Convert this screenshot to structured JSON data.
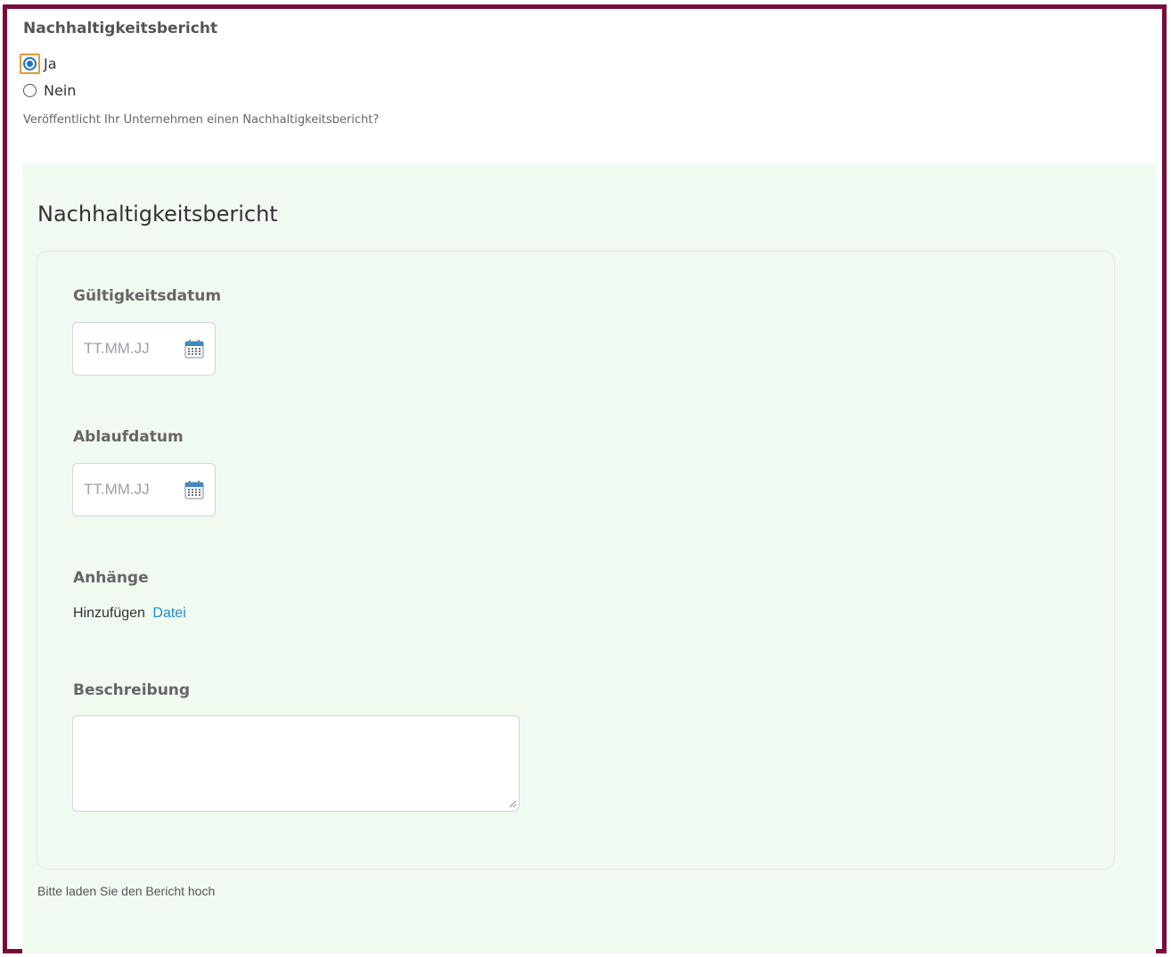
{
  "question": {
    "label": "Nachhaltigkeitsbericht",
    "options": [
      {
        "label": "Ja",
        "checked": true
      },
      {
        "label": "Nein",
        "checked": false
      }
    ],
    "hint": "Veröffentlicht Ihr Unternehmen einen Nachhaltigkeitsbericht?"
  },
  "section": {
    "title": "Nachhaltigkeitsbericht",
    "fields": {
      "gueltigkeitsdatum": {
        "label": "Gültigkeitsdatum",
        "placeholder": "TT.MM.JJ",
        "icon": "calendar-icon"
      },
      "ablaufdatum": {
        "label": "Ablaufdatum",
        "placeholder": "TT.MM.JJ",
        "icon": "calendar-icon"
      },
      "anhaenge": {
        "label": "Anhänge",
        "static_text": "Hinzufügen",
        "link_text": "Datei"
      },
      "beschreibung": {
        "label": "Beschreibung",
        "value": ""
      }
    },
    "hint": "Bitte laden Sie den Bericht hoch"
  },
  "colors": {
    "frame_border": "#7a0a3a",
    "section_background": "#f1faf1",
    "radio_accent": "#1a73c9",
    "focus_outline": "#e19a3a",
    "link": "#1a8dd1"
  }
}
